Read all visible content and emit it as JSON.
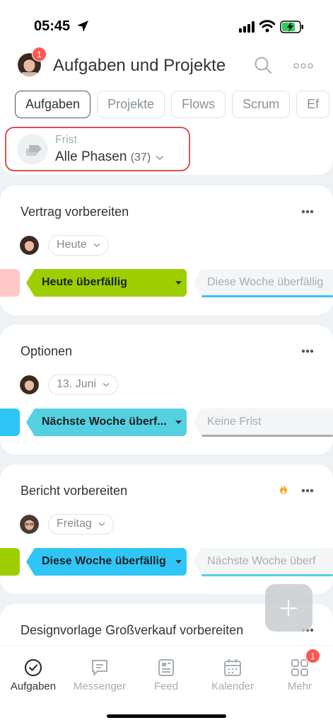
{
  "status_bar": {
    "time": "05:45"
  },
  "header": {
    "title": "Aufgaben und Projekte",
    "avatar_badge": "1"
  },
  "tabs": [
    {
      "label": "Aufgaben",
      "active": true
    },
    {
      "label": "Projekte",
      "active": false
    },
    {
      "label": "Flows",
      "active": false
    },
    {
      "label": "Scrum",
      "active": false
    },
    {
      "label": "Ef",
      "active": false
    }
  ],
  "filter": {
    "label": "Frist",
    "value": "Alle Phasen",
    "count": "(37)"
  },
  "tasks": [
    {
      "title": "Vertrag vorbereiten",
      "date": "Heute",
      "stage": "Heute überfällig",
      "stage_color": "#9dcf00",
      "next_stage": "Diese Woche überfällig",
      "next_color": "#2fc6f6",
      "stub_color": "#ffc7c7",
      "flame": false
    },
    {
      "title": "Optionen",
      "date": "13. Juni",
      "stage": "Nächste Woche überf...",
      "stage_color": "#55d0e0",
      "next_stage": "Keine Frist",
      "next_color": "#a8adb4",
      "stub_color": "#2fc6f6",
      "flame": false
    },
    {
      "title": "Bericht vorbereiten",
      "date": "Freitag",
      "stage": "Diese Woche überfällig",
      "stage_color": "#2fc6f6",
      "next_stage": "Nächste Woche überf",
      "next_color": "#55d0e0",
      "stub_color": "#9dcf00",
      "flame": true
    },
    {
      "title": "Designvorlage Großverkauf vorbereiten"
    }
  ],
  "bottom_nav": [
    {
      "label": "Aufgaben",
      "icon": "check-circle-icon",
      "active": true
    },
    {
      "label": "Messenger",
      "icon": "chat-icon",
      "active": false
    },
    {
      "label": "Feed",
      "icon": "feed-icon",
      "active": false
    },
    {
      "label": "Kalender",
      "icon": "calendar-icon",
      "active": false
    },
    {
      "label": "Mehr",
      "icon": "grid-icon",
      "active": false,
      "badge": "1"
    }
  ]
}
